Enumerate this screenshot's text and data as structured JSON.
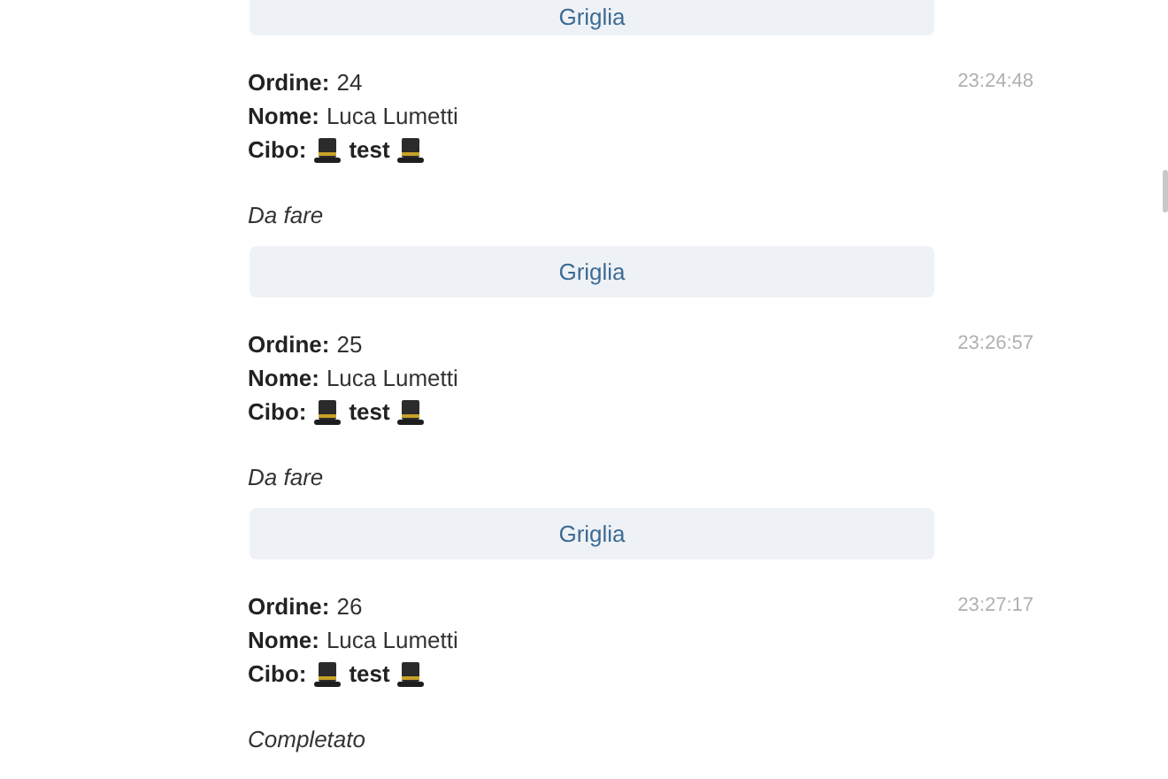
{
  "top_button": {
    "label": "Griglia"
  },
  "messages": [
    {
      "lines": [
        {
          "kind": "text",
          "text": "**Ordine:** 24"
        },
        {
          "kind": "text",
          "text": "**Nome:** Luca Lumetti"
        },
        {
          "kind": "food",
          "label": "Cibo:",
          "value": "test"
        }
      ],
      "time": "23:24:48",
      "status": "Da fare",
      "button": "Griglia"
    },
    {
      "lines": [
        {
          "kind": "text",
          "text": "**Ordine:** 25"
        },
        {
          "kind": "text",
          "text": "**Nome:** Luca Lumetti"
        },
        {
          "kind": "food",
          "label": "Cibo:",
          "value": "test"
        }
      ],
      "time": "23:26:57",
      "status": "Da fare",
      "button": "Griglia"
    },
    {
      "lines": [
        {
          "kind": "text",
          "text": "**Ordine:** 26"
        },
        {
          "kind": "text",
          "text": "**Nome:** Luca Lumetti"
        },
        {
          "kind": "food",
          "label": "Cibo:",
          "value": "test"
        }
      ],
      "time": "23:27:17",
      "status": "Completato"
    }
  ]
}
